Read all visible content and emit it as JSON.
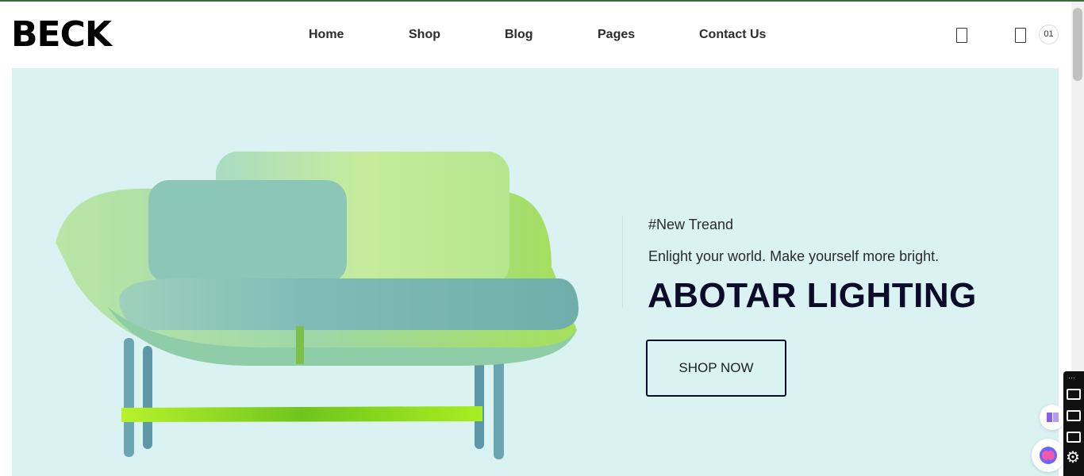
{
  "brand": {
    "logo": "BECK"
  },
  "nav": {
    "items": [
      "Home",
      "Shop",
      "Blog",
      "Pages",
      "Contact Us"
    ]
  },
  "header_icons": {
    "first_icon": "search-icon",
    "second_icon": "cart-icon",
    "cart_count": "01"
  },
  "hero": {
    "tag": "#New Treand",
    "subtitle": "Enlight your world. Make yourself more bright.",
    "title": "ABOTAR LIGHTING",
    "button_label": "SHOP NOW",
    "background_color": "#dbf2f2"
  },
  "colors": {
    "title": "#0b0c2a",
    "top_border": "#3d6b3d"
  }
}
